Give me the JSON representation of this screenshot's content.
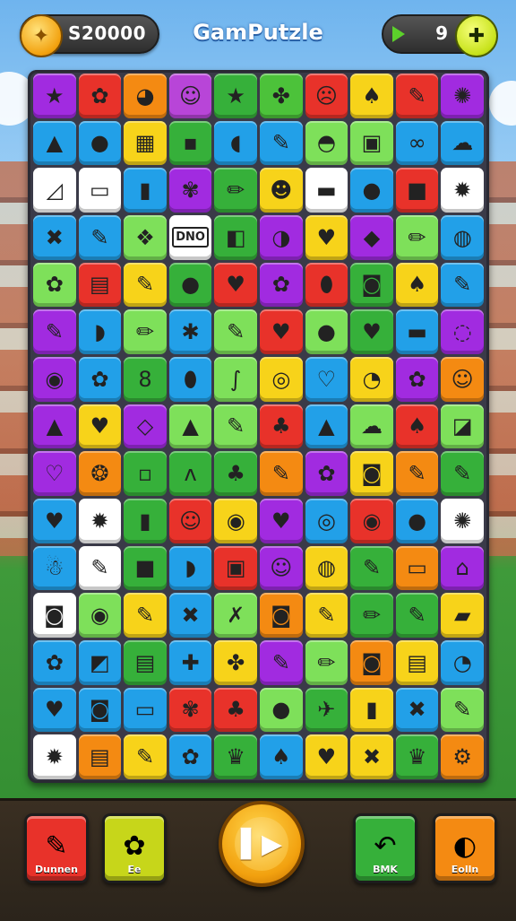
{
  "header": {
    "coins": "S20000",
    "title": "GamPutzle",
    "gems": "9",
    "coin_icon": "coin-star-icon",
    "gem_icon": "green-gem-icon",
    "plus_icon": "add-currency-icon"
  },
  "board": {
    "rows": [
      [
        {
          "c": "#a12be0",
          "g": "★"
        },
        {
          "c": "#e8322a",
          "g": "✿"
        },
        {
          "c": "#f48a12",
          "g": "◕"
        },
        {
          "c": "#b845d8",
          "g": "☺"
        },
        {
          "c": "#36b03a",
          "g": "★"
        },
        {
          "c": "#4cc23a",
          "g": "✤"
        },
        {
          "c": "#e8322a",
          "g": "☹"
        },
        {
          "c": "#f7d31a",
          "g": "♠"
        },
        {
          "c": "#e8322a",
          "g": "✎"
        },
        {
          "c": "#a12be0",
          "g": "✺"
        }
      ],
      [
        {
          "c": "#22a0e8",
          "g": "▲"
        },
        {
          "c": "#22a0e8",
          "g": "●"
        },
        {
          "c": "#f7d31a",
          "g": "▦"
        },
        {
          "c": "#36b03a",
          "g": "▪"
        },
        {
          "c": "#22a0e8",
          "g": "◖"
        },
        {
          "c": "#22a0e8",
          "g": "✎"
        },
        {
          "c": "#7ee05a",
          "g": "◓"
        },
        {
          "c": "#7ee05a",
          "g": "▣"
        },
        {
          "c": "#22a0e8",
          "g": "∞"
        },
        {
          "c": "#22a0e8",
          "g": "☁"
        }
      ],
      [
        {
          "c": "#ffffff",
          "g": "◿"
        },
        {
          "c": "#ffffff",
          "g": "▭"
        },
        {
          "c": "#22a0e8",
          "g": "▮"
        },
        {
          "c": "#a12be0",
          "g": "✾"
        },
        {
          "c": "#36b03a",
          "g": "✏"
        },
        {
          "c": "#f7d31a",
          "g": "☻"
        },
        {
          "c": "#ffffff",
          "g": "▬"
        },
        {
          "c": "#22a0e8",
          "g": "●"
        },
        {
          "c": "#e8322a",
          "g": "■"
        },
        {
          "c": "#ffffff",
          "g": "✹"
        }
      ],
      [
        {
          "c": "#22a0e8",
          "g": "✖"
        },
        {
          "c": "#22a0e8",
          "g": "✎"
        },
        {
          "c": "#7ee05a",
          "g": "❖"
        },
        {
          "c": "#ffffff",
          "g": "DNO"
        },
        {
          "c": "#36b03a",
          "g": "◧"
        },
        {
          "c": "#a12be0",
          "g": "◑"
        },
        {
          "c": "#f7d31a",
          "g": "♥"
        },
        {
          "c": "#a12be0",
          "g": "◆"
        },
        {
          "c": "#7ee05a",
          "g": "✏"
        },
        {
          "c": "#22a0e8",
          "g": "◍"
        }
      ],
      [
        {
          "c": "#7ee05a",
          "g": "✿"
        },
        {
          "c": "#e8322a",
          "g": "▤"
        },
        {
          "c": "#f7d31a",
          "g": "✎"
        },
        {
          "c": "#36b03a",
          "g": "●"
        },
        {
          "c": "#e8322a",
          "g": "♥"
        },
        {
          "c": "#a12be0",
          "g": "✿"
        },
        {
          "c": "#e8322a",
          "g": "⬮"
        },
        {
          "c": "#36b03a",
          "g": "◙"
        },
        {
          "c": "#f7d31a",
          "g": "♠"
        },
        {
          "c": "#22a0e8",
          "g": "✎"
        }
      ],
      [
        {
          "c": "#a12be0",
          "g": "✎"
        },
        {
          "c": "#22a0e8",
          "g": "◗"
        },
        {
          "c": "#7ee05a",
          "g": "✏"
        },
        {
          "c": "#22a0e8",
          "g": "✱"
        },
        {
          "c": "#7ee05a",
          "g": "✎"
        },
        {
          "c": "#e8322a",
          "g": "♥"
        },
        {
          "c": "#7ee05a",
          "g": "●"
        },
        {
          "c": "#36b03a",
          "g": "♥"
        },
        {
          "c": "#22a0e8",
          "g": "▬"
        },
        {
          "c": "#a12be0",
          "g": "◌"
        }
      ],
      [
        {
          "c": "#a12be0",
          "g": "◉"
        },
        {
          "c": "#22a0e8",
          "g": "✿"
        },
        {
          "c": "#36b03a",
          "g": "8"
        },
        {
          "c": "#22a0e8",
          "g": "⬮"
        },
        {
          "c": "#7ee05a",
          "g": "∫"
        },
        {
          "c": "#f7d31a",
          "g": "◎"
        },
        {
          "c": "#22a0e8",
          "g": "♡"
        },
        {
          "c": "#f7d31a",
          "g": "◔"
        },
        {
          "c": "#a12be0",
          "g": "✿"
        },
        {
          "c": "#f48a12",
          "g": "☺"
        }
      ],
      [
        {
          "c": "#a12be0",
          "g": "▲"
        },
        {
          "c": "#f7d31a",
          "g": "♥"
        },
        {
          "c": "#a12be0",
          "g": "◇"
        },
        {
          "c": "#7ee05a",
          "g": "▲"
        },
        {
          "c": "#7ee05a",
          "g": "✎"
        },
        {
          "c": "#e8322a",
          "g": "♣"
        },
        {
          "c": "#22a0e8",
          "g": "▲"
        },
        {
          "c": "#7ee05a",
          "g": "☁"
        },
        {
          "c": "#e8322a",
          "g": "♠"
        },
        {
          "c": "#7ee05a",
          "g": "◪"
        }
      ],
      [
        {
          "c": "#a12be0",
          "g": "♡"
        },
        {
          "c": "#f48a12",
          "g": "❂"
        },
        {
          "c": "#36b03a",
          "g": "▫"
        },
        {
          "c": "#36b03a",
          "g": "ʌ"
        },
        {
          "c": "#36b03a",
          "g": "♣"
        },
        {
          "c": "#f48a12",
          "g": "✎"
        },
        {
          "c": "#a12be0",
          "g": "✿"
        },
        {
          "c": "#f7d31a",
          "g": "◙"
        },
        {
          "c": "#f48a12",
          "g": "✎"
        },
        {
          "c": "#36b03a",
          "g": "✎"
        }
      ],
      [
        {
          "c": "#22a0e8",
          "g": "♥"
        },
        {
          "c": "#ffffff",
          "g": "✹"
        },
        {
          "c": "#36b03a",
          "g": "▮"
        },
        {
          "c": "#e8322a",
          "g": "☺"
        },
        {
          "c": "#f7d31a",
          "g": "◉"
        },
        {
          "c": "#a12be0",
          "g": "♥"
        },
        {
          "c": "#22a0e8",
          "g": "◎"
        },
        {
          "c": "#e8322a",
          "g": "◉"
        },
        {
          "c": "#22a0e8",
          "g": "●"
        },
        {
          "c": "#ffffff",
          "g": "✺"
        }
      ],
      [
        {
          "c": "#22a0e8",
          "g": "☃"
        },
        {
          "c": "#ffffff",
          "g": "✎"
        },
        {
          "c": "#36b03a",
          "g": "■"
        },
        {
          "c": "#22a0e8",
          "g": "◗"
        },
        {
          "c": "#e8322a",
          "g": "▣"
        },
        {
          "c": "#a12be0",
          "g": "☺"
        },
        {
          "c": "#f7d31a",
          "g": "◍"
        },
        {
          "c": "#36b03a",
          "g": "✎"
        },
        {
          "c": "#f48a12",
          "g": "▭"
        },
        {
          "c": "#a12be0",
          "g": "⌂"
        }
      ],
      [
        {
          "c": "#ffffff",
          "g": "◙"
        },
        {
          "c": "#7ee05a",
          "g": "◉"
        },
        {
          "c": "#f7d31a",
          "g": "✎"
        },
        {
          "c": "#22a0e8",
          "g": "✖"
        },
        {
          "c": "#7ee05a",
          "g": "✗"
        },
        {
          "c": "#f48a12",
          "g": "◙"
        },
        {
          "c": "#f7d31a",
          "g": "✎"
        },
        {
          "c": "#36b03a",
          "g": "✏"
        },
        {
          "c": "#36b03a",
          "g": "✎"
        },
        {
          "c": "#f7d31a",
          "g": "▰"
        }
      ],
      [
        {
          "c": "#22a0e8",
          "g": "✿"
        },
        {
          "c": "#22a0e8",
          "g": "◩"
        },
        {
          "c": "#36b03a",
          "g": "▤"
        },
        {
          "c": "#22a0e8",
          "g": "✚"
        },
        {
          "c": "#f7d31a",
          "g": "✤"
        },
        {
          "c": "#a12be0",
          "g": "✎"
        },
        {
          "c": "#7ee05a",
          "g": "✏"
        },
        {
          "c": "#f48a12",
          "g": "◙"
        },
        {
          "c": "#f7d31a",
          "g": "▤"
        },
        {
          "c": "#22a0e8",
          "g": "◔"
        }
      ],
      [
        {
          "c": "#22a0e8",
          "g": "♥"
        },
        {
          "c": "#22a0e8",
          "g": "◙"
        },
        {
          "c": "#22a0e8",
          "g": "▭"
        },
        {
          "c": "#e8322a",
          "g": "✾"
        },
        {
          "c": "#e8322a",
          "g": "♣"
        },
        {
          "c": "#7ee05a",
          "g": "●"
        },
        {
          "c": "#36b03a",
          "g": "✈"
        },
        {
          "c": "#f7d31a",
          "g": "▮"
        },
        {
          "c": "#22a0e8",
          "g": "✖"
        },
        {
          "c": "#7ee05a",
          "g": "✎"
        }
      ],
      [
        {
          "c": "#ffffff",
          "g": "✹"
        },
        {
          "c": "#f48a12",
          "g": "▤"
        },
        {
          "c": "#f7d31a",
          "g": "✎"
        },
        {
          "c": "#22a0e8",
          "g": "✿"
        },
        {
          "c": "#36b03a",
          "g": "♛"
        },
        {
          "c": "#22a0e8",
          "g": "♠"
        },
        {
          "c": "#f7d31a",
          "g": "♥"
        },
        {
          "c": "#f7d31a",
          "g": "✖"
        },
        {
          "c": "#36b03a",
          "g": "♛"
        },
        {
          "c": "#f48a12",
          "g": "⚙"
        }
      ]
    ]
  },
  "bottom": {
    "btn1": {
      "label": "Dunnen",
      "icon": "pencil-icon",
      "glyph": "✎",
      "color": "#e8322a"
    },
    "btn2": {
      "label": "Ee",
      "icon": "gear-icon",
      "glyph": "✿",
      "color": "#c7d61a"
    },
    "play": {
      "icon": "play-icon",
      "glyph": "▌▶"
    },
    "btn3": {
      "label": "BMK",
      "icon": "undo-arrow-icon",
      "glyph": "↶",
      "color": "#36b03a"
    },
    "btn4": {
      "label": "Eolln",
      "icon": "shell-icon",
      "glyph": "◐",
      "color": "#f48a12"
    }
  }
}
